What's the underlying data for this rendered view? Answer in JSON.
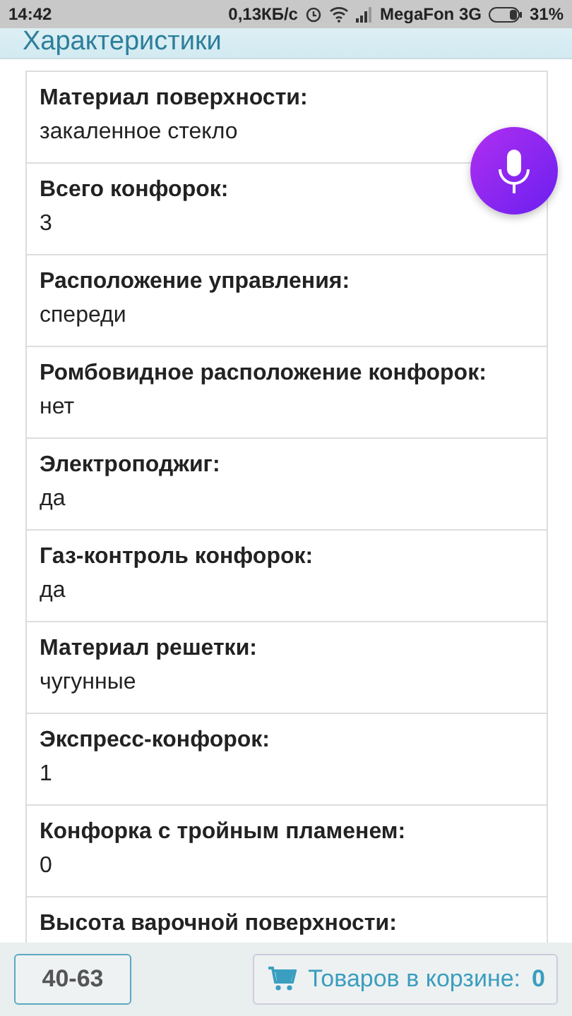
{
  "status_bar": {
    "time": "14:42",
    "speed": "0,13КБ/с",
    "carrier": "MegaFon 3G",
    "battery": "31%"
  },
  "header": {
    "title": "Характеристики"
  },
  "specs": [
    {
      "label": "Материал поверхности:",
      "value": "закаленное стекло"
    },
    {
      "label": "Всего конфорок:",
      "value": "3"
    },
    {
      "label": "Расположение управления:",
      "value": "спереди"
    },
    {
      "label": "Ромбовидное расположение конфорок:",
      "value": "нет"
    },
    {
      "label": "Электроподжиг:",
      "value": "да"
    },
    {
      "label": "Газ-контроль конфорок:",
      "value": "да"
    },
    {
      "label": "Материал решетки:",
      "value": "чугунные"
    },
    {
      "label": "Экспресс-конфорок:",
      "value": "1"
    },
    {
      "label": "Конфорка с тройным пламенем:",
      "value": "0"
    },
    {
      "label": "Высота варочной поверхности:"
    }
  ],
  "bottom_bar": {
    "phone_button": "40-63",
    "cart_label": "Товаров в корзине:",
    "cart_count": "0"
  }
}
